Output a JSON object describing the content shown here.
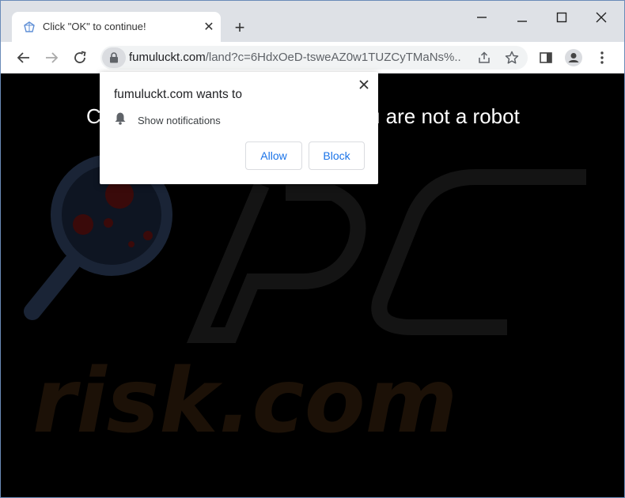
{
  "tab": {
    "title": "Click \"OK\" to continue!",
    "close_glyph": "✕",
    "new_tab_glyph": "+"
  },
  "window_controls": [
    "minimize-icon",
    "maximize-icon",
    "close-icon"
  ],
  "toolbar": {
    "url_host": "fumuluckt.com",
    "url_rest": "/land?c=6HdxOeD-tsweAZ0w1TUZCyTMaNs%..."
  },
  "page": {
    "headline_left": "C",
    "headline_right": "u are not a robot",
    "watermark": {
      "line1": "PC",
      "line2": "risk.com"
    }
  },
  "permission_popup": {
    "title": "fumuluckt.com wants to",
    "permission_label": "Show notifications",
    "allow_label": "Allow",
    "block_label": "Block"
  },
  "colors": {
    "tabstrip": "#dee1e6",
    "accent_button_text": "#1a73e8",
    "page_background": "#000000",
    "window_border": "#6a8bb8"
  }
}
